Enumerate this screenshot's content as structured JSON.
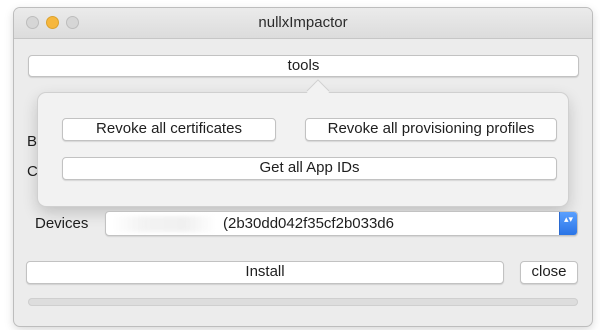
{
  "window": {
    "title": "nullxImpactor"
  },
  "toolbar": {
    "tools_label": "tools"
  },
  "popover": {
    "revoke_certificates_label": "Revoke all certificates",
    "revoke_profiles_label": "Revoke all provisioning profiles",
    "get_app_ids_label": "Get all App IDs"
  },
  "hidden_labels": {
    "b_label": "B",
    "c_label": "C"
  },
  "devices": {
    "label": "Devices",
    "selected_value": "(2b30dd042f35cf2b033d6",
    "stepper_glyph": "▴▾"
  },
  "actions": {
    "install_label": "Install",
    "close_label": "close"
  },
  "progress": {
    "value_fraction": 0
  },
  "colors": {
    "accent": "#2a74e6",
    "window_bg": "#ececec"
  }
}
